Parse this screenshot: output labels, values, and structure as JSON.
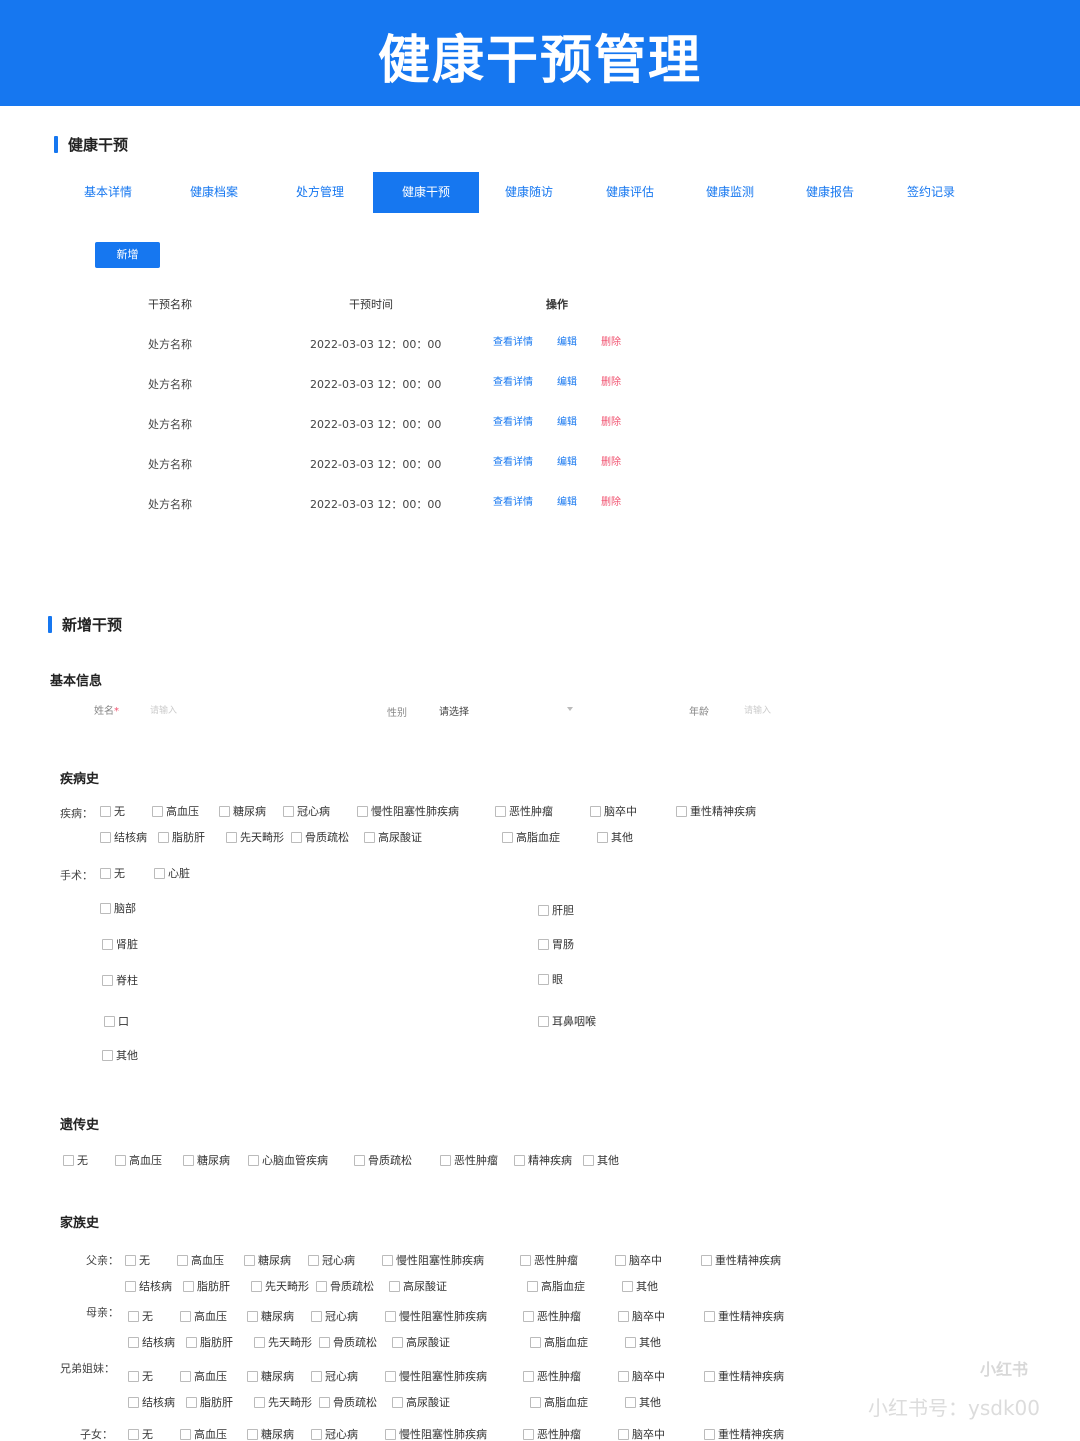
{
  "banner": {
    "title": "健康干预管理"
  },
  "section1": {
    "title": "健康干预"
  },
  "tabs": [
    {
      "label": "基本详情"
    },
    {
      "label": "健康档案"
    },
    {
      "label": "处方管理"
    },
    {
      "label": "健康干预"
    },
    {
      "label": "健康随访"
    },
    {
      "label": "健康评估"
    },
    {
      "label": "健康监测"
    },
    {
      "label": "健康报告"
    },
    {
      "label": "签约记录"
    }
  ],
  "active_tab": "健康干预",
  "new_button": "新增",
  "table": {
    "headers": [
      "干预名称",
      "干预时间",
      "操作"
    ],
    "rows": [
      {
        "name": "处方名称",
        "time": "2022-03-03  12：00：00"
      },
      {
        "name": "处方名称",
        "time": "2022-03-03  12：00：00"
      },
      {
        "name": "处方名称",
        "time": "2022-03-03  12：00：00"
      },
      {
        "name": "处方名称",
        "time": "2022-03-03  12：00：00"
      },
      {
        "name": "处方名称",
        "time": "2022-03-03  12：00：00"
      }
    ],
    "actions": {
      "view": "查看详情",
      "edit": "编辑",
      "delete": "删除"
    }
  },
  "section2": {
    "title": "新增干预"
  },
  "basic_info": {
    "title": "基本信息",
    "name_label": "姓名",
    "required_mark": "*",
    "name_placeholder": "请输入",
    "gender_label": "性别",
    "gender_value": "请选择",
    "age_label": "年龄",
    "age_placeholder": "请输入"
  },
  "disease_history": {
    "title": "疾病史",
    "disease_label": "疾病：",
    "surgery_label": "手术："
  },
  "disease_options": [
    "无",
    "高血压",
    "糖尿病",
    "冠心病",
    "慢性阻塞性肺疾病",
    "恶性肿瘤",
    "脑卒中",
    "重性精神疾病",
    "结核病",
    "脂肪肝",
    "先天畸形",
    "骨质疏松",
    "高尿酸证",
    "高脂血症",
    "其他"
  ],
  "surgery_options": [
    "无",
    "心脏",
    "脑部",
    "肝胆",
    "肾脏",
    "胃肠",
    "脊柱",
    "眼",
    "口",
    "耳鼻咽喉",
    "其他"
  ],
  "genetic_history": {
    "title": "遗传史",
    "options": [
      "无",
      "高血压",
      "糖尿病",
      "心脑血管疾病",
      "骨质疏松",
      "恶性肿瘤",
      "精神疾病",
      "其他"
    ]
  },
  "family_history": {
    "title": "家族史",
    "members": [
      "父亲：",
      "母亲：",
      "兄弟姐妹：",
      "子女："
    ]
  },
  "watermark": {
    "logo": "小红书",
    "id": "小红书号：ysdk00"
  },
  "colors": {
    "primary": "#1677f0",
    "danger": "#f0506e"
  }
}
